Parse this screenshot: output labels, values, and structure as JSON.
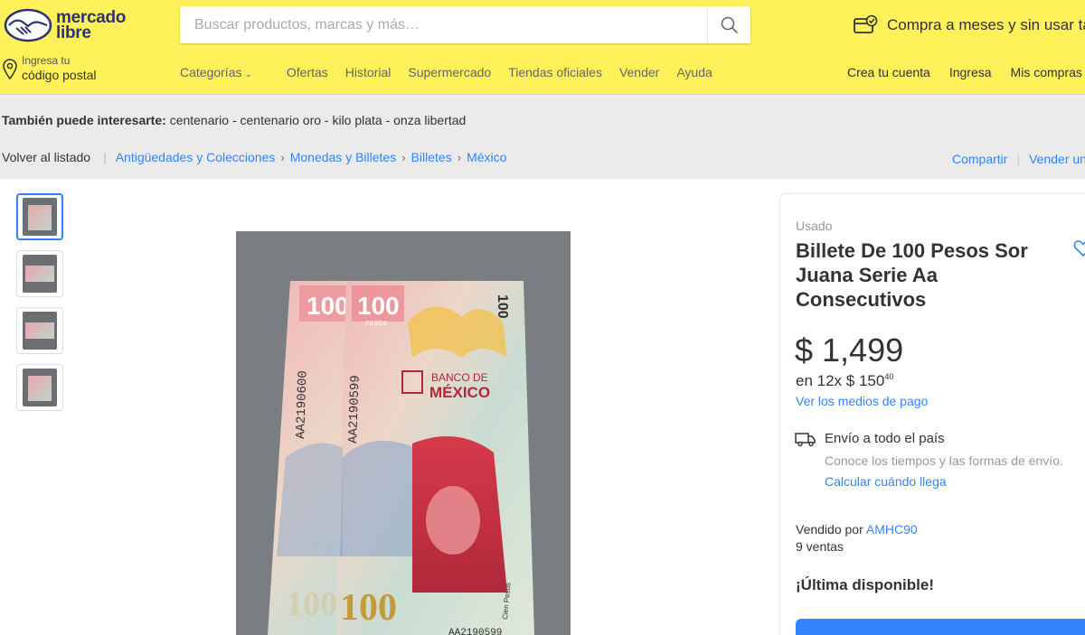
{
  "header": {
    "logo_line1": "mercado",
    "logo_line2": "libre",
    "search_placeholder": "Buscar productos, marcas y más…",
    "promo_text": "Compra a meses y sin usar tarjeta",
    "location_small": "Ingresa tu",
    "location_big": "código postal",
    "nav": [
      "Categorías",
      "Ofertas",
      "Historial",
      "Supermercado",
      "Tiendas oficiales",
      "Vender",
      "Ayuda"
    ],
    "user_nav": [
      "Crea tu cuenta",
      "Ingresa",
      "Mis compras"
    ],
    "brand_color": "#fff159"
  },
  "related": {
    "label": "También puede interesarte:",
    "items": "centenario - centenario oro - kilo plata - onza libertad"
  },
  "breadcrumb": {
    "back": "Volver al listado",
    "items": [
      "Antigüedades y Colecciones",
      "Monedas y Billetes",
      "Billetes",
      "México"
    ],
    "share": "Compartir",
    "sell": "Vender uno igual"
  },
  "gallery": {
    "thumbnail_count": 4,
    "photo": {
      "bank_name_1": "BANCO DE",
      "bank_name_2": "MÉXICO",
      "denomination": "100",
      "currency_word": "PESOS",
      "serial_left": "AA2190600",
      "serial_right": "AA2190599",
      "cien_pesos": "Cien Pesos",
      "bottom_serial": "AA2190599"
    }
  },
  "product": {
    "condition": "Usado",
    "title": "Billete De 100 Pesos Sor Juana Serie Aa Consecutivos",
    "currency": "$",
    "price": "1,499",
    "installments_prefix": "en 12x $ 150",
    "installments_cents": "40",
    "payment_link": "Ver los medios de pago",
    "shipping_title": "Envío a todo el país",
    "shipping_sub": "Conoce los tiempos y las formas de envío.",
    "shipping_link": "Calcular cuándo llega",
    "seller_prefix": "Vendido por",
    "seller_name": "AMHC90",
    "sales": "9 ventas",
    "stock": "¡Última disponible!",
    "accent_color": "#3483fa"
  }
}
